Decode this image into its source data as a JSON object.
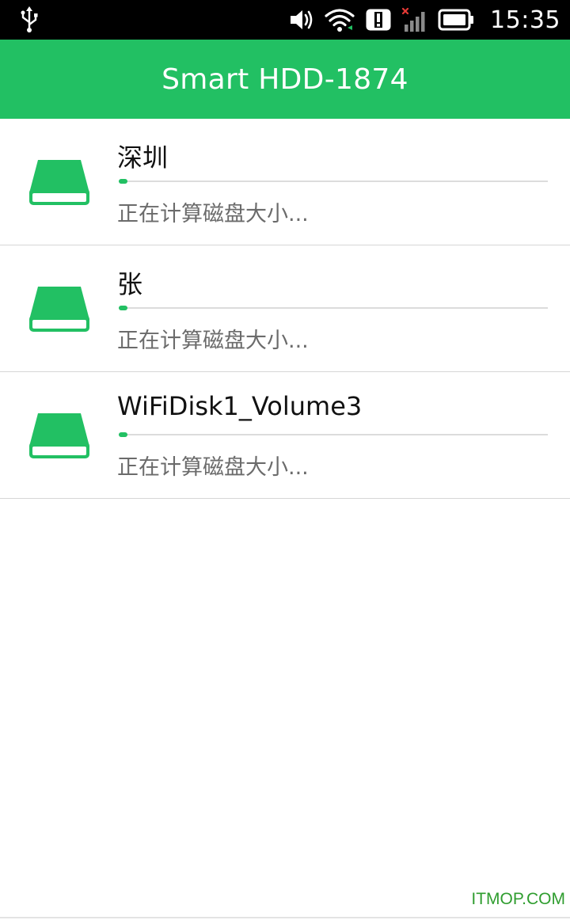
{
  "status_bar": {
    "time": "15:35",
    "icons": [
      "usb-icon",
      "volume-icon",
      "wifi-icon",
      "alert-icon",
      "signal-icon",
      "battery-icon"
    ]
  },
  "app_bar": {
    "title": "Smart HDD-1874"
  },
  "colors": {
    "accent": "#22c063",
    "status_bar": "#000000",
    "divider": "#d6d6d6",
    "secondary_text": "#6b6b6b",
    "watermark": "#2f9d2f"
  },
  "disks": [
    {
      "name": "深圳",
      "status": "正在计算磁盘大小...",
      "progress": 0.02,
      "icon": "hard-drive-icon"
    },
    {
      "name": "张",
      "status": "正在计算磁盘大小...",
      "progress": 0.02,
      "icon": "hard-drive-icon"
    },
    {
      "name": "WiFiDisk1_Volume3",
      "status": "正在计算磁盘大小...",
      "progress": 0.02,
      "icon": "hard-drive-icon"
    }
  ],
  "watermark": "ITMOP.COM"
}
